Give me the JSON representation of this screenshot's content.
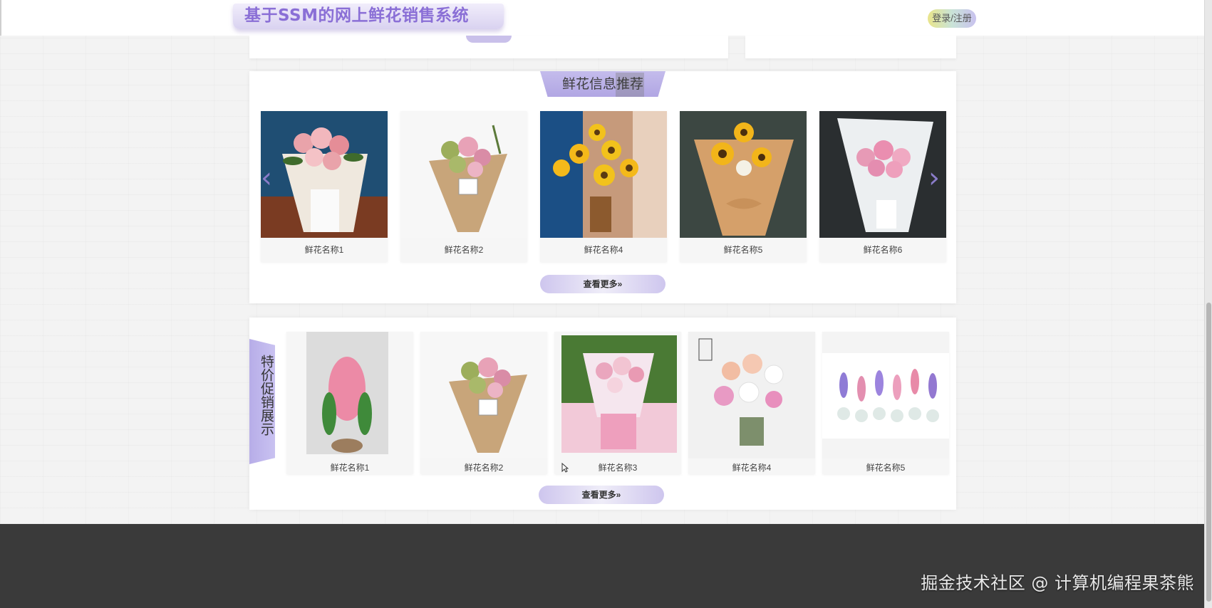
{
  "header": {
    "site_title": "基于SSM的网上鲜花销售系统",
    "login_label": "登录/注册"
  },
  "recommend": {
    "title": "鲜花信息推荐",
    "items": [
      {
        "name": "鲜花名称1",
        "image": "pink-rose-bouquet-white-wrap"
      },
      {
        "name": "鲜花名称2",
        "image": "mixed-bouquet-kraft-wrap"
      },
      {
        "name": "鲜花名称4",
        "image": "sunflowers-in-basket"
      },
      {
        "name": "鲜花名称5",
        "image": "sunflower-bouquet-kraft-wrap"
      },
      {
        "name": "鲜花名称6",
        "image": "pink-peony-bouquet-white-wrap"
      }
    ],
    "more_label": "查看更多»"
  },
  "promo": {
    "title": "特价促销展示",
    "items": [
      {
        "name": "鲜花名称1",
        "image": "pink-hyacinth-pot"
      },
      {
        "name": "鲜花名称2",
        "image": "mixed-bouquet-kraft-wrap"
      },
      {
        "name": "鲜花名称3",
        "image": "pink-rose-bouquet-pink-wrap"
      },
      {
        "name": "鲜花名称4",
        "image": "pink-gerbera-vase"
      },
      {
        "name": "鲜花名称5",
        "image": "hyacinth-glass-bulbs"
      }
    ],
    "more_label": "查看更多»"
  },
  "watermark": "掘金技术社区 @ 计算机编程果茶熊",
  "colors": {
    "accent": "#b1a6e3",
    "title_text": "#8a6fd6",
    "footer": "#3a3a3a"
  }
}
